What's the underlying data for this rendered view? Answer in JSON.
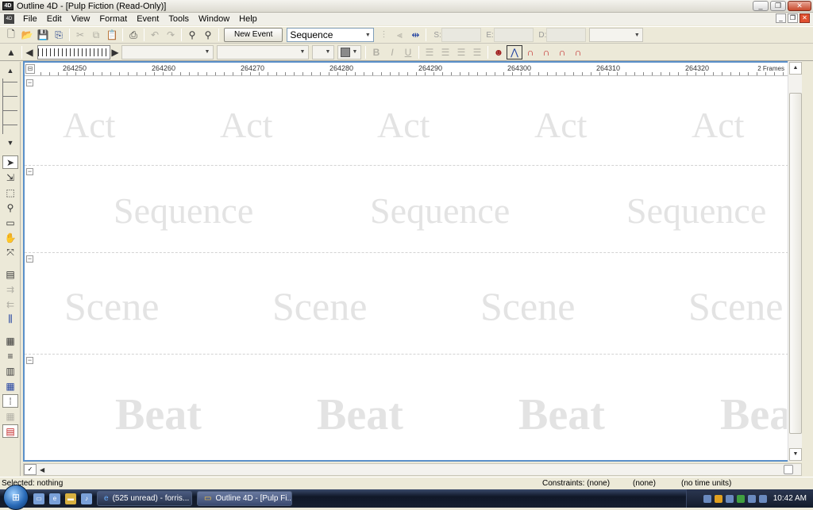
{
  "window": {
    "title": "Outline 4D - [Pulp Fiction (Read-Only)]",
    "app_icon": "4D"
  },
  "menu": [
    "File",
    "Edit",
    "View",
    "Format",
    "Event",
    "Tools",
    "Window",
    "Help"
  ],
  "toolbar": {
    "new_event_label": "New Event",
    "level_select": "Sequence",
    "field_labels": [
      "S:",
      "E:",
      "D:"
    ]
  },
  "ruler": {
    "ticks": [
      "264250",
      "264260",
      "264270",
      "264280",
      "264290",
      "264300",
      "264310",
      "264320"
    ],
    "unit_label": "2 Frames"
  },
  "lanes": {
    "act": "Act",
    "sequence": "Sequence",
    "scene": "Scene",
    "beat": "Beat",
    "beat_partial": "Bea"
  },
  "status": {
    "selection": "Selected: nothing",
    "constraints": "Constraints: (none)",
    "constraints_value": "(none)",
    "time_units": "(no time units)"
  },
  "taskbar": {
    "tasks": [
      {
        "label": "(525 unread) - forris..."
      },
      {
        "label": "Outline 4D - [Pulp Fi..."
      }
    ],
    "clock": "10:42 AM"
  }
}
